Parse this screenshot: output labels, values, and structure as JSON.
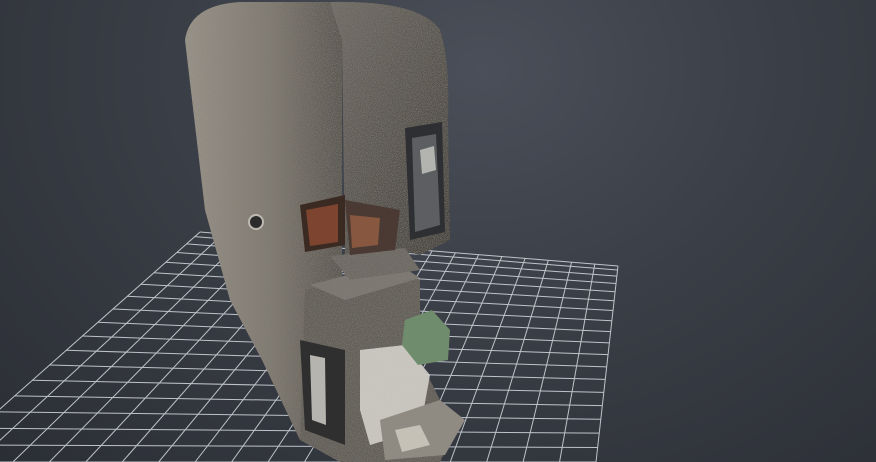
{
  "viewer": {
    "background_top": "#4a4f59",
    "background_bottom": "#2b2e35",
    "grid_color": "#d7dbe2"
  },
  "scene": {
    "subject": "point-cloud-scan",
    "surface_color": "#8a8780",
    "shadow_color": "#4d4b47",
    "rust_color": "#8a4a33",
    "green_patch_color": "#6f8d6c",
    "white_patch_color": "#e8e6df"
  }
}
